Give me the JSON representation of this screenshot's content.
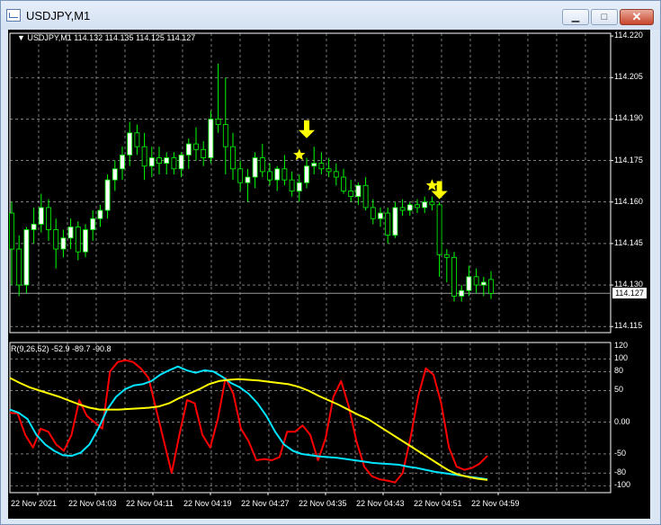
{
  "window": {
    "title": "USDJPY,M1",
    "minimize_label": "▁",
    "maximize_label": "□",
    "close_label": "✕"
  },
  "main_chart": {
    "info": "▼ USDJPY,M1  114.132 114.135 114.125 114.127",
    "current_price": "114.127",
    "price_ticks": [
      "114.220",
      "114.205",
      "114.190",
      "114.175",
      "114.160",
      "114.145",
      "114.130",
      "114.115"
    ],
    "price_range": [
      114.1128,
      114.221
    ]
  },
  "indicator": {
    "info": "R(9,26,52) -52.9 -89.7 -90.8",
    "ticks": [
      "120",
      "100",
      "80",
      "50",
      "0.00",
      "-50",
      "-80",
      "-100"
    ]
  },
  "time_labels": [
    "22 Nov 2021",
    "22 Nov 04:03",
    "22 Nov 04:11",
    "22 Nov 04:19",
    "22 Nov 04:27",
    "22 Nov 04:35",
    "22 Nov 04:43",
    "22 Nov 04:51",
    "22 Nov 04:59"
  ],
  "colors": {
    "background": "#000000",
    "grid": "#c8c8c8",
    "bull_candle": "#ffffff",
    "bear_candle": "#000000",
    "wick": "#00ff00",
    "signal": "#ffff00",
    "line_red": "#ff0000",
    "line_cyan": "#00e5ff",
    "line_yellow": "#ffff00"
  },
  "chart_data": {
    "type": "candlestick",
    "symbol": "USDJPY",
    "timeframe": "M1",
    "last_bar": {
      "open": 114.132,
      "high": 114.135,
      "low": 114.125,
      "close": 114.127
    },
    "candles": [
      [
        114.156,
        114.16,
        114.13,
        114.143
      ],
      [
        114.143,
        114.148,
        114.126,
        114.13
      ],
      [
        114.13,
        114.151,
        114.127,
        114.15
      ],
      [
        114.15,
        114.158,
        114.145,
        114.152
      ],
      [
        114.152,
        114.163,
        114.149,
        114.158
      ],
      [
        114.158,
        114.161,
        114.146,
        114.15
      ],
      [
        114.15,
        114.154,
        114.136,
        114.143
      ],
      [
        114.143,
        114.15,
        114.14,
        114.147
      ],
      [
        114.147,
        114.154,
        114.143,
        114.151
      ],
      [
        114.151,
        114.153,
        114.139,
        114.142
      ],
      [
        114.142,
        114.152,
        114.14,
        114.15
      ],
      [
        114.15,
        114.157,
        114.146,
        114.154
      ],
      [
        114.154,
        114.159,
        114.151,
        114.157
      ],
      [
        114.157,
        114.17,
        114.154,
        114.168
      ],
      [
        114.168,
        114.175,
        114.164,
        114.172
      ],
      [
        114.172,
        114.18,
        114.168,
        114.177
      ],
      [
        114.177,
        114.189,
        114.173,
        114.185
      ],
      [
        114.185,
        114.188,
        114.177,
        114.18
      ],
      [
        114.18,
        114.185,
        114.168,
        114.173
      ],
      [
        114.173,
        114.18,
        114.169,
        114.176
      ],
      [
        114.176,
        114.18,
        114.17,
        114.174
      ],
      [
        114.174,
        114.178,
        114.17,
        114.176
      ],
      [
        114.176,
        114.178,
        114.17,
        114.172
      ],
      [
        114.172,
        114.178,
        114.169,
        114.177
      ],
      [
        114.177,
        114.183,
        114.172,
        114.181
      ],
      [
        114.181,
        114.187,
        114.175,
        114.179
      ],
      [
        114.179,
        114.182,
        114.173,
        114.176
      ],
      [
        114.176,
        114.193,
        114.174,
        114.19
      ],
      [
        114.19,
        114.21,
        114.185,
        114.188
      ],
      [
        114.188,
        114.205,
        114.17,
        114.18
      ],
      [
        114.18,
        114.185,
        114.168,
        114.172
      ],
      [
        114.172,
        114.175,
        114.164,
        114.167
      ],
      [
        114.167,
        114.172,
        114.16,
        114.169
      ],
      [
        114.169,
        114.178,
        114.165,
        114.176
      ],
      [
        114.176,
        114.181,
        114.169,
        114.171
      ],
      [
        114.171,
        114.174,
        114.166,
        114.168
      ],
      [
        114.168,
        114.173,
        114.164,
        114.172
      ],
      [
        114.172,
        114.177,
        114.166,
        114.168
      ],
      [
        114.168,
        114.171,
        114.162,
        114.164
      ],
      [
        114.164,
        114.17,
        114.16,
        114.167
      ],
      [
        114.167,
        114.176,
        114.165,
        114.173
      ],
      [
        114.173,
        114.18,
        114.17,
        114.174
      ],
      [
        114.174,
        114.178,
        114.17,
        114.172
      ],
      [
        114.172,
        114.176,
        114.169,
        114.171
      ],
      [
        114.171,
        114.174,
        114.166,
        114.169
      ],
      [
        114.169,
        114.172,
        114.163,
        114.164
      ],
      [
        114.164,
        114.168,
        114.16,
        114.162
      ],
      [
        114.162,
        114.167,
        114.159,
        114.166
      ],
      [
        114.166,
        114.169,
        114.157,
        114.158
      ],
      [
        114.158,
        114.161,
        114.152,
        114.154
      ],
      [
        114.154,
        114.158,
        114.151,
        114.156
      ],
      [
        114.156,
        114.158,
        114.145,
        114.148
      ],
      [
        114.148,
        114.16,
        114.147,
        114.158
      ],
      [
        114.158,
        114.161,
        114.155,
        114.157
      ],
      [
        114.157,
        114.16,
        114.155,
        114.159
      ],
      [
        114.159,
        114.161,
        114.156,
        114.158
      ],
      [
        114.158,
        114.162,
        114.156,
        114.16
      ],
      [
        114.16,
        114.162,
        114.157,
        114.159
      ],
      [
        114.159,
        114.16,
        114.133,
        114.141
      ],
      [
        114.141,
        114.143,
        114.131,
        114.14
      ],
      [
        114.14,
        114.142,
        114.124,
        114.126
      ],
      [
        114.126,
        114.13,
        114.124,
        114.128
      ],
      [
        114.128,
        114.137,
        114.126,
        114.133
      ],
      [
        114.133,
        114.136,
        114.127,
        114.13
      ],
      [
        114.13,
        114.133,
        114.126,
        114.131
      ],
      [
        114.132,
        114.135,
        114.125,
        114.127
      ]
    ],
    "signals": [
      {
        "type": "arrow-down",
        "bar": 40,
        "price": 114.185
      },
      {
        "type": "star",
        "bar": 39,
        "price": 114.177
      },
      {
        "type": "arrow-down",
        "bar": 58,
        "price": 114.163
      },
      {
        "type": "star",
        "bar": 57,
        "price": 114.166
      }
    ],
    "indicator_range": [
      -111,
      123
    ],
    "indicator_series": [
      {
        "values": [
          15,
          14,
          -20,
          -40,
          -10,
          -15,
          -35,
          -45,
          -20,
          35,
          10,
          0,
          -10,
          80,
          95,
          98,
          95,
          85,
          70,
          20,
          -30,
          -80,
          -20,
          35,
          30,
          -20,
          -40,
          5,
          70,
          45,
          -10,
          -30,
          -60,
          -58,
          -60,
          -55,
          -15,
          -15,
          -5,
          -20,
          -60,
          -25,
          40,
          65,
          25,
          -30,
          -70,
          -85,
          -90,
          -92,
          -95,
          -80,
          -25,
          40,
          85,
          75,
          30,
          -40,
          -70,
          -75,
          -72,
          -65,
          -53
        ]
      },
      {
        "values": [
          20,
          15,
          5,
          -20,
          -35,
          -45,
          -52,
          -53,
          -48,
          -35,
          -10,
          20,
          40,
          52,
          58,
          60,
          65,
          75,
          82,
          88,
          82,
          78,
          82,
          80,
          72,
          62,
          55,
          45,
          30,
          10,
          -15,
          -35,
          -45,
          -50,
          -52,
          -54,
          -55,
          -56,
          -58,
          -60,
          -62,
          -64,
          -65,
          -66,
          -67,
          -70,
          -72,
          -75,
          -78,
          -80,
          -82,
          -84,
          -86,
          -88,
          -90
        ]
      },
      {
        "values": [
          70,
          62,
          55,
          50,
          45,
          40,
          34,
          28,
          23,
          20,
          20,
          20,
          21,
          22,
          23,
          25,
          30,
          38,
          45,
          52,
          60,
          65,
          67,
          68,
          67,
          66,
          64,
          62,
          60,
          56,
          50,
          42,
          35,
          28,
          20,
          12,
          5,
          -5,
          -15,
          -25,
          -35,
          -45,
          -55,
          -65,
          -75,
          -82,
          -86,
          -89,
          -91
        ]
      }
    ]
  }
}
